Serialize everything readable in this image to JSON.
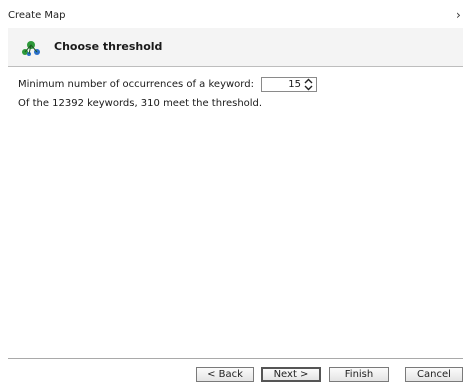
{
  "window": {
    "title": "Create Map",
    "close_glyph": "›"
  },
  "header": {
    "title": "Choose threshold",
    "icon": "map-wizard-icon"
  },
  "threshold": {
    "label": "Minimum number of occurrences of a keyword:",
    "value": "15"
  },
  "summary": "Of the 12392 keywords, 310 meet the threshold.",
  "buttons": {
    "back": "< Back",
    "next": "Next >",
    "finish": "Finish",
    "cancel": "Cancel"
  },
  "colors": {
    "icon_green": "#2e9a3a",
    "icon_blue": "#2a6fc9",
    "header_bg": "#f4f4f4"
  }
}
